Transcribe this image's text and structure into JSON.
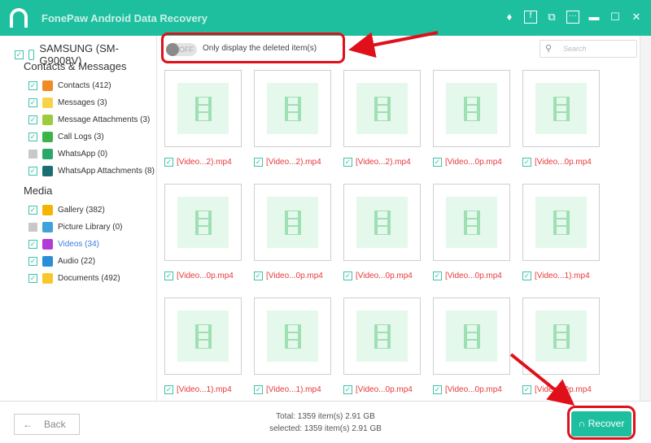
{
  "app": {
    "title": "FonePaw Android Data Recovery",
    "brand_color": "#1ebf9f",
    "title_icons": [
      "diamond-icon",
      "facebook-icon",
      "feedback-icon",
      "menu-icon",
      "minimize-icon",
      "maximize-icon",
      "close-icon"
    ]
  },
  "sidebar": {
    "device": "SAMSUNG (SM-G9008V)",
    "sections": [
      {
        "title": "Contacts & Messages",
        "items": [
          {
            "label": "Contacts (412)",
            "checked": true,
            "icon": "contacts-icon",
            "color": "#f08a24"
          },
          {
            "label": "Messages (3)",
            "checked": true,
            "icon": "messages-icon",
            "color": "#f7d34a"
          },
          {
            "label": "Message Attachments (3)",
            "checked": true,
            "icon": "attachment-icon",
            "color": "#9ccc3c"
          },
          {
            "label": "Call Logs (3)",
            "checked": true,
            "icon": "phone-icon",
            "color": "#3cb44a"
          },
          {
            "label": "WhatsApp (0)",
            "checked": false,
            "icon": "whatsapp-icon",
            "color": "#2aa86a"
          },
          {
            "label": "WhatsApp Attachments (8)",
            "checked": true,
            "icon": "whatsapp-attachment-icon",
            "color": "#1b6e72"
          }
        ]
      },
      {
        "title": "Media",
        "items": [
          {
            "label": "Gallery (382)",
            "checked": true,
            "icon": "gallery-icon",
            "color": "#f5b400"
          },
          {
            "label": "Picture Library (0)",
            "checked": false,
            "icon": "picture-library-icon",
            "color": "#3fa3d9"
          },
          {
            "label": "Videos (34)",
            "checked": true,
            "icon": "video-icon",
            "color": "#b23ad6",
            "active": true
          },
          {
            "label": "Audio (22)",
            "checked": true,
            "icon": "audio-icon",
            "color": "#2a8fd6"
          },
          {
            "label": "Documents (492)",
            "checked": true,
            "icon": "folder-icon",
            "color": "#f8c82a"
          }
        ]
      }
    ]
  },
  "toolbar": {
    "toggle_state": "OFF",
    "toggle_label": "Only display the deleted item(s)",
    "search_placeholder": "Search"
  },
  "files": [
    "[Video...2).mp4",
    "[Video...2).mp4",
    "[Video...2).mp4",
    "[Video...0p.mp4",
    "[Video...0p.mp4",
    "[Video...0p.mp4",
    "[Video...0p.mp4",
    "[Video...0p.mp4",
    "[Video...0p.mp4",
    "[Video...1).mp4",
    "[Video...1).mp4",
    "[Video...1).mp4",
    "[Video...0p.mp4",
    "[Video...0p.mp4",
    "[Video...0p.mp4"
  ],
  "footer": {
    "back": "Back",
    "total": "Total: 1359 item(s) 2.91 GB",
    "selected": "selected: 1359 item(s) 2.91 GB",
    "recover": "Recover"
  }
}
